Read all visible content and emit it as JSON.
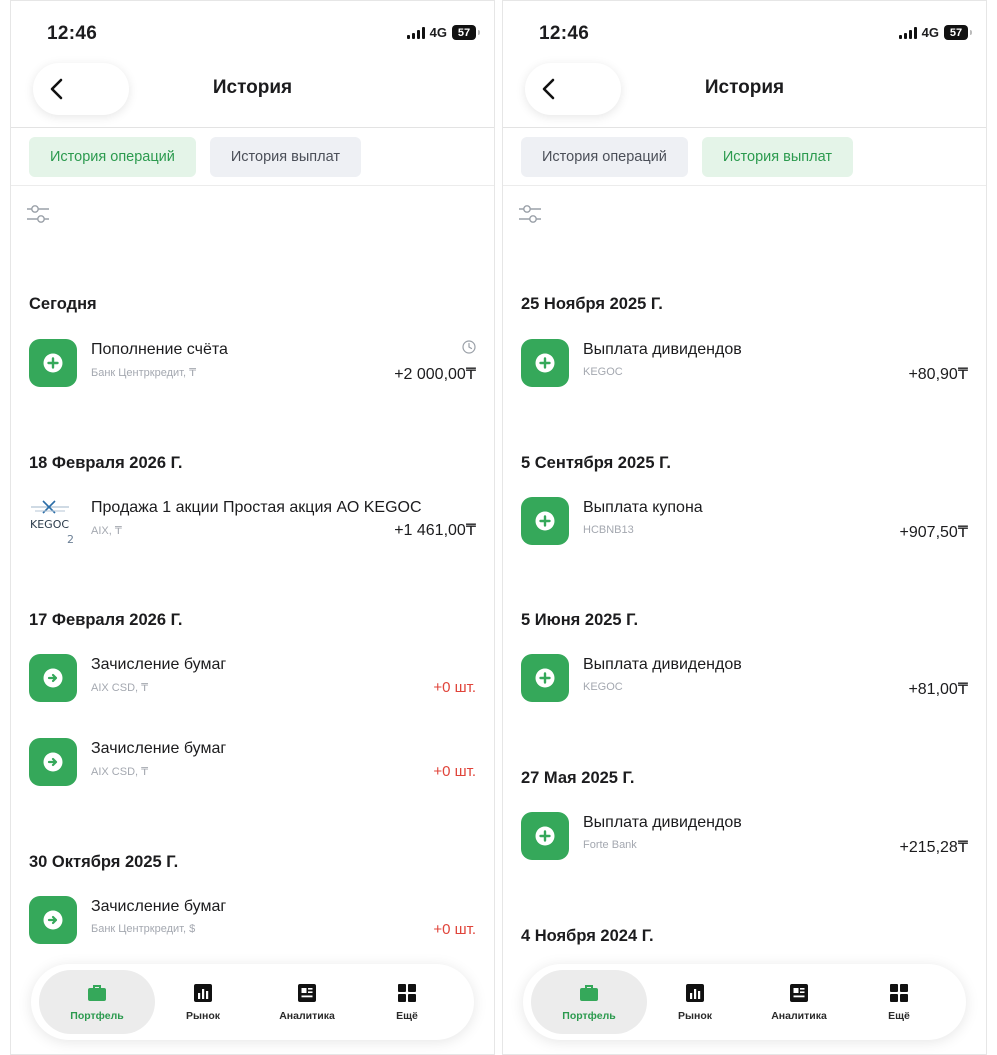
{
  "status": {
    "time": "12:46",
    "network": "4G",
    "battery": "57"
  },
  "header": {
    "title": "История"
  },
  "tabs": {
    "operations": "История операций",
    "payouts": "История выплат"
  },
  "left": {
    "groups": [
      {
        "date": "Сегодня",
        "items": [
          {
            "icon": "plus-icon",
            "title": "Пополнение счёта",
            "subtitle": "Банк Центркредит, ₸",
            "amount": "+2 000,00₸",
            "pending": true
          }
        ]
      },
      {
        "date": "18 Февраля 2026 Г.",
        "items": [
          {
            "icon": "kegoc-logo",
            "title": "Продажа 1 акции Простая акция АО KEGOC",
            "subtitle": "AIX, ₸",
            "amount": "+1 461,00₸"
          }
        ]
      },
      {
        "date": "17 Февраля 2026 Г.",
        "items": [
          {
            "icon": "arrow-right-icon",
            "title": "Зачисление бумаг",
            "subtitle": "AIX CSD, ₸",
            "amount": "+0 шт."
          },
          {
            "icon": "arrow-right-icon",
            "title": "Зачисление бумаг",
            "subtitle": "AIX CSD, ₸",
            "amount": "+0 шт."
          }
        ]
      },
      {
        "date": "30 Октября 2025 Г.",
        "items": [
          {
            "icon": "arrow-right-icon",
            "title": "Зачисление бумаг",
            "subtitle": "Банк Центркредит, $",
            "amount": "+0 шт."
          }
        ]
      }
    ]
  },
  "right": {
    "groups": [
      {
        "date": "25 Ноября 2025 Г.",
        "items": [
          {
            "icon": "plus-icon",
            "title": "Выплата дивидендов",
            "subtitle": "KEGOC",
            "amount": "+80,90₸"
          }
        ]
      },
      {
        "date": "5 Сентября 2025 Г.",
        "items": [
          {
            "icon": "plus-icon",
            "title": "Выплата купона",
            "subtitle": "HCBNB13",
            "amount": "+907,50₸"
          }
        ]
      },
      {
        "date": "5 Июня 2025 Г.",
        "items": [
          {
            "icon": "plus-icon",
            "title": "Выплата дивидендов",
            "subtitle": "KEGOC",
            "amount": "+81,00₸"
          }
        ]
      },
      {
        "date": "27 Мая 2025 Г.",
        "items": [
          {
            "icon": "plus-icon",
            "title": "Выплата дивидендов",
            "subtitle": "Forte Bank",
            "amount": "+215,28₸"
          }
        ]
      },
      {
        "date": "4 Ноября 2024 Г."
      }
    ]
  },
  "tabbar": {
    "portfolio": "Портфель",
    "market": "Рынок",
    "analytics": "Аналитика",
    "more": "Ещё"
  },
  "kegoc_logo": {
    "wordmark": "KEGOC",
    "digit": "2"
  },
  "colors": {
    "accent": "#35a85a",
    "negative": "#e0443a",
    "active_tab_bg": "#e4f4e8"
  }
}
